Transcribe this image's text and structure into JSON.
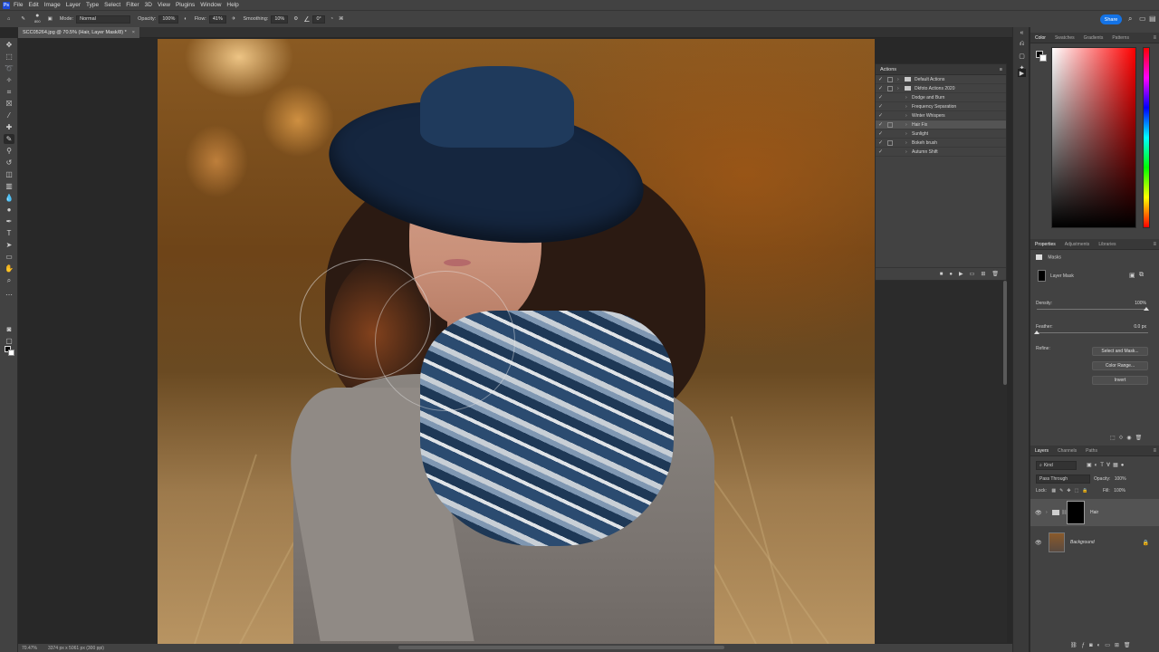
{
  "menubar": {
    "app_icon": "Ps",
    "items": [
      "File",
      "Edit",
      "Image",
      "Layer",
      "Type",
      "Select",
      "Filter",
      "3D",
      "View",
      "Plugins",
      "Window",
      "Help"
    ]
  },
  "options": {
    "brush_size": "800",
    "mode_label": "Mode:",
    "mode_value": "Normal",
    "opacity_label": "Opacity:",
    "opacity_value": "100%",
    "flow_label": "Flow:",
    "flow_value": "41%",
    "smoothing_label": "Smoothing:",
    "smoothing_value": "10%",
    "angle_value": "0°",
    "share_label": "Share"
  },
  "document": {
    "tab_title": "SCC05264.jpg @ 70.5% (Hair, Layer Mask/8) *",
    "close": "×",
    "zoom": "70.47%",
    "info": "3374 px x 5061 px (300 ppi)"
  },
  "actions_panel": {
    "title": "Actions",
    "menu": "≡",
    "items": [
      {
        "label": "Default Actions",
        "level": 0,
        "folder": true,
        "dialog": true,
        "selected": false
      },
      {
        "label": "Dkfoto Actions 2020",
        "level": 0,
        "folder": true,
        "dialog": true,
        "selected": false
      },
      {
        "label": "Dodge and Burn",
        "level": 1,
        "folder": false,
        "dialog": false,
        "selected": false
      },
      {
        "label": "Frequency Separation",
        "level": 1,
        "folder": false,
        "dialog": false,
        "selected": false
      },
      {
        "label": "Winter Whispers",
        "level": 1,
        "folder": false,
        "dialog": false,
        "selected": false
      },
      {
        "label": "Hair Fix",
        "level": 1,
        "folder": false,
        "dialog": true,
        "selected": true
      },
      {
        "label": "Sunlight",
        "level": 1,
        "folder": false,
        "dialog": false,
        "selected": false
      },
      {
        "label": "Bokeh brush",
        "level": 1,
        "folder": false,
        "dialog": true,
        "selected": false
      },
      {
        "label": "Autumn Shift",
        "level": 1,
        "folder": false,
        "dialog": false,
        "selected": false
      }
    ]
  },
  "color_panel": {
    "tabs": [
      "Color",
      "Swatches",
      "Gradients",
      "Patterns"
    ]
  },
  "properties_panel": {
    "tabs": [
      "Properties",
      "Adjustments",
      "Libraries"
    ],
    "section": "Masks",
    "mask_label": "Layer Mask",
    "density_label": "Density:",
    "density_value": "100%",
    "feather_label": "Feather:",
    "feather_value": "0.0 px",
    "refine_label": "Refine:",
    "btn_select_mask": "Select and Mask...",
    "btn_color_range": "Color Range...",
    "btn_invert": "Invert"
  },
  "layers_panel": {
    "tabs": [
      "Layers",
      "Channels",
      "Paths"
    ],
    "filter_kind": "Kind",
    "blend_mode": "Pass Through",
    "opacity_label": "Opacity:",
    "opacity_value": "100%",
    "lock_label": "Lock:",
    "fill_label": "Fill:",
    "fill_value": "100%",
    "layers": [
      {
        "name": "Hair",
        "selected": true
      },
      {
        "name": "Background",
        "selected": false
      }
    ]
  }
}
